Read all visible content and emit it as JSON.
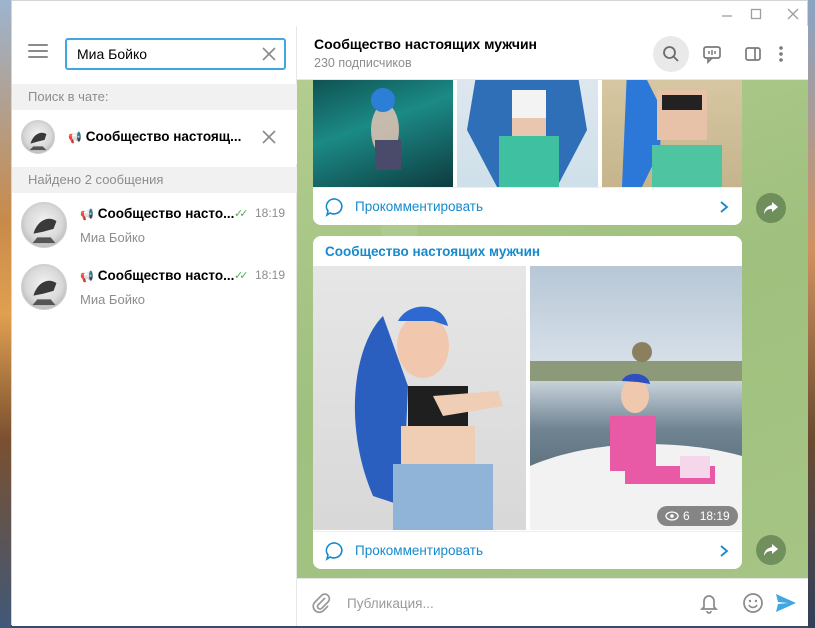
{
  "window": {
    "controls": {
      "minimize_icon": "minimize-icon",
      "maximize_icon": "maximize-icon",
      "close_icon": "close-icon"
    }
  },
  "sidebar": {
    "search": {
      "value": "Миа Бойко",
      "placeholder": ""
    },
    "in_chat_label": "Поиск в чате:",
    "current_chat": {
      "name": "Сообщество настоящ..."
    },
    "results_label": "Найдено 2 сообщения",
    "results": [
      {
        "channel": "Сообщество насто...",
        "time": "18:19",
        "sender": "Миа Бойко"
      },
      {
        "channel": "Сообщество насто...",
        "time": "18:19",
        "sender": "Миа Бойко"
      }
    ]
  },
  "header": {
    "title": "Сообщество настоящих мужчин",
    "subtitle": "230 подписчиков"
  },
  "messages": [
    {
      "comment_label": "Прокомментировать"
    },
    {
      "channel_title": "Сообщество настоящих мужчин",
      "views": "6",
      "time": "18:19",
      "comment_label": "Прокомментировать"
    }
  ],
  "composer": {
    "placeholder": "Публикация..."
  },
  "colors": {
    "accent": "#40a7e3",
    "link": "#168acd",
    "read_ticks": "#4fae4e",
    "chat_bg": "#a9c78a"
  }
}
